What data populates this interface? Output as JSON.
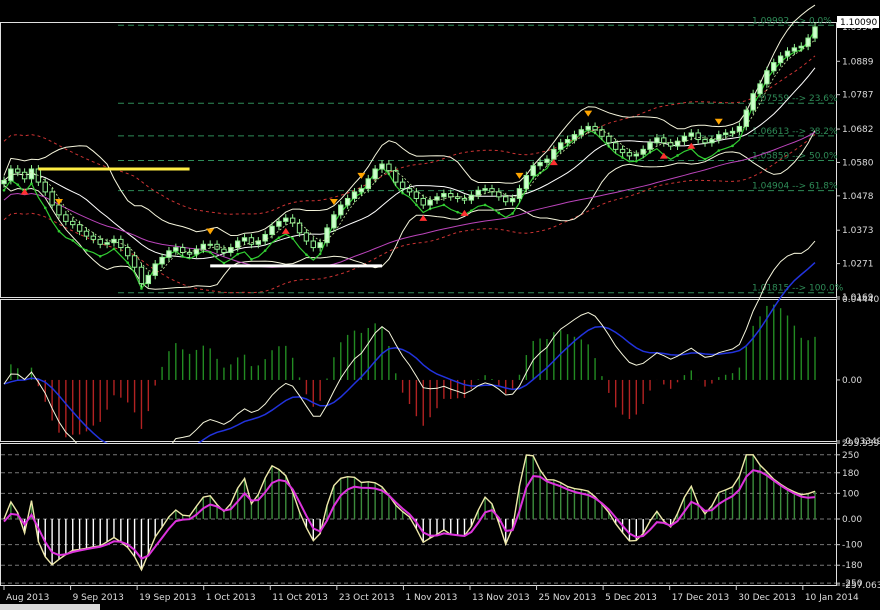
{
  "chart_data": [
    {
      "type": "candlestick",
      "panel": "price",
      "symbol_price_label": "1.10090",
      "ylim": [
        1.0169,
        1.1009
      ],
      "y_ticks": [
        "1.0169",
        "1.0271",
        "1.0373",
        "1.0478",
        "1.0580",
        "1.0682",
        "1.0787",
        "1.0889",
        "1.0994"
      ],
      "grid": false,
      "fibonacci_levels": [
        {
          "price": 1.0999,
          "label": "1.09992 --> 0.0%"
        },
        {
          "price": 1.0761,
          "label": "1.07559 --> 23.6%"
        },
        {
          "price": 1.0661,
          "label": "1.06613 --> 38.2%"
        },
        {
          "price": 1.0586,
          "label": "1.05859 --> 50.0%"
        },
        {
          "price": 1.0494,
          "label": "1.04904 --> 61.8%"
        },
        {
          "price": 1.0182,
          "label": "1.01815 --> 100.0%"
        }
      ],
      "close": [
        1.0525,
        1.056,
        1.055,
        1.053,
        1.056,
        1.052,
        1.049,
        1.045,
        1.042,
        1.04,
        1.039,
        1.037,
        1.0355,
        1.0345,
        1.033,
        1.0335,
        1.0345,
        1.032,
        1.0295,
        1.026,
        1.021,
        1.0235,
        1.027,
        1.029,
        1.031,
        1.032,
        1.0305,
        1.03,
        1.0315,
        1.033,
        1.033,
        1.0315,
        1.0305,
        1.032,
        1.034,
        1.035,
        1.033,
        1.034,
        1.036,
        1.0385,
        1.04,
        1.041,
        1.0395,
        1.0365,
        1.034,
        1.032,
        1.0335,
        1.038,
        1.042,
        1.045,
        1.047,
        1.049,
        1.05,
        1.053,
        1.056,
        1.0575,
        1.0555,
        1.052,
        1.05,
        1.049,
        1.047,
        1.045,
        1.0465,
        1.0475,
        1.0485,
        1.0475,
        1.047,
        1.0465,
        1.048,
        1.0495,
        1.05,
        1.049,
        1.0475,
        1.046,
        1.047,
        1.05,
        1.054,
        1.057,
        1.058,
        1.059,
        1.062,
        1.064,
        1.065,
        1.0665,
        1.068,
        1.069,
        1.068,
        1.066,
        1.064,
        1.062,
        1.061,
        1.06,
        1.0605,
        1.062,
        1.064,
        1.0655,
        1.064,
        1.063,
        1.0645,
        1.066,
        1.067,
        1.065,
        1.064,
        1.065,
        1.0665,
        1.067,
        1.0675,
        1.069,
        1.074,
        1.079,
        1.082,
        1.086,
        1.0885,
        1.0905,
        1.092,
        1.093,
        1.0935,
        1.096,
        1.0994
      ],
      "x_tick_labels": [
        "Aug 2013",
        "9 Sep 2013",
        "19 Sep 2013",
        "1 Oct 2013",
        "11 Oct 2013",
        "23 Oct 2013",
        "1 Nov 2013",
        "13 Nov 2013",
        "25 Nov 2013",
        "5 Dec 2013",
        "17 Dec 2013",
        "30 Dec 2013",
        "10 Jan 2014"
      ],
      "colors": {
        "candle": "#90ee90",
        "bollinger": "#f5f5dc",
        "envelope": "#cc3333",
        "ma_fast": "#ffffff",
        "ma_slow": "#bb44bb",
        "psar": "#32cd32",
        "fibo": "#2e8b57",
        "signal_up": "#ff3030",
        "signal_down": "#ffa500",
        "resistance": "#ffee44",
        "support": "#ffffff"
      }
    },
    {
      "type": "histogram_line",
      "panel": "macd",
      "ylim": [
        -0.033493,
        0.044405
      ],
      "y_ticks": [
        "0.044405",
        "0.00",
        "-0.033493"
      ],
      "colors": {
        "positive": "#228b22",
        "negative": "#b22222",
        "macd": "#f5f5dc",
        "signal": "#2233dd"
      }
    },
    {
      "type": "histogram_line",
      "panel": "cci",
      "ylim": [
        -257.0634,
        295.9391
      ],
      "y_ticks": [
        "295.9391",
        "250",
        "180",
        "100",
        "0.00",
        "-100",
        "-180",
        "-250",
        "-257.0634"
      ],
      "colors": {
        "positive": "#3c8c3c",
        "negative_fill": "#ffffff",
        "line_a": "#eee8aa",
        "line_b": "#dd33dd"
      }
    }
  ]
}
